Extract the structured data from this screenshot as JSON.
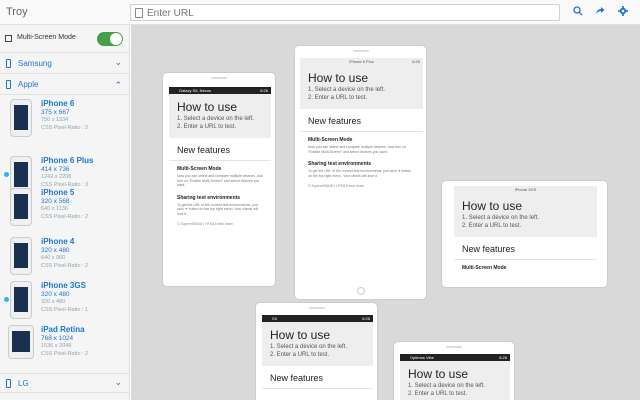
{
  "app": {
    "title": "Troy"
  },
  "url": {
    "placeholder": "Enter URL"
  },
  "toolbar": {
    "search_icon": "search-icon",
    "forward_icon": "forward-icon",
    "settings_icon": "gear-icon"
  },
  "sidebar": {
    "multi_screen_label": "Multi-Screen Mode",
    "multi_screen_on": true,
    "groups": [
      {
        "label": "Samsung",
        "expanded": false
      },
      {
        "label": "Apple",
        "expanded": true
      },
      {
        "label": "LG",
        "expanded": false
      }
    ],
    "devices": [
      {
        "name": "iPhone 6",
        "res": "375 x 667",
        "res2": "750 x 1334",
        "ratio": "CSS Pixel-Ratio : 2",
        "active": false
      },
      {
        "name": "iPhone 6 Plus",
        "res": "414 x 736",
        "res2": "1242 x 2208",
        "ratio": "CSS Pixel-Ratio : 3",
        "active": true
      },
      {
        "name": "iPhone 5",
        "res": "320 x 568",
        "res2": "640 x 1136",
        "ratio": "CSS Pixel-Ratio : 2",
        "active": false
      },
      {
        "name": "iPhone 4",
        "res": "320 x 480",
        "res2": "640 x 960",
        "ratio": "CSS Pixel-Ratio : 2",
        "active": false
      },
      {
        "name": "iPhone 3GS",
        "res": "320 x 480",
        "res2": "320 x 480",
        "ratio": "CSS Pixel-Ratio : 1",
        "active": true
      },
      {
        "name": "iPad Retina",
        "res": "768 x 1024",
        "res2": "1536 x 2048",
        "ratio": "CSS Pixel-Ratio : 2",
        "active": false
      }
    ]
  },
  "preview": {
    "how_title": "How to use",
    "how_line1": "1. Select a device on the left.",
    "how_line2": "2. Enter a URL to test.",
    "nf_title": "New features",
    "ms_head": "Multi-Screen Mode",
    "ms_text": "Now you can select and compare multiple devices. Just turn on \"Enable Multi-Screen\" and select devices you want.",
    "share_head": "Sharing test environments",
    "share_text": "To get the URL of the current test environments, just click ➔ button on the top right menu. Your clients will love it.",
    "footer": "© SquirrelSAND | HTML5 tech team",
    "status": {
      "f1": "Galaxy S5, Nexus",
      "f1_time": "6:26",
      "f2": "iPhone 6 Plus",
      "f2_time": "6:26",
      "f3": "iPhone 3GS",
      "f4": "S3",
      "f4_time": "6:26",
      "f5": "Optimus Vibe",
      "f5_time": "6:26"
    }
  }
}
